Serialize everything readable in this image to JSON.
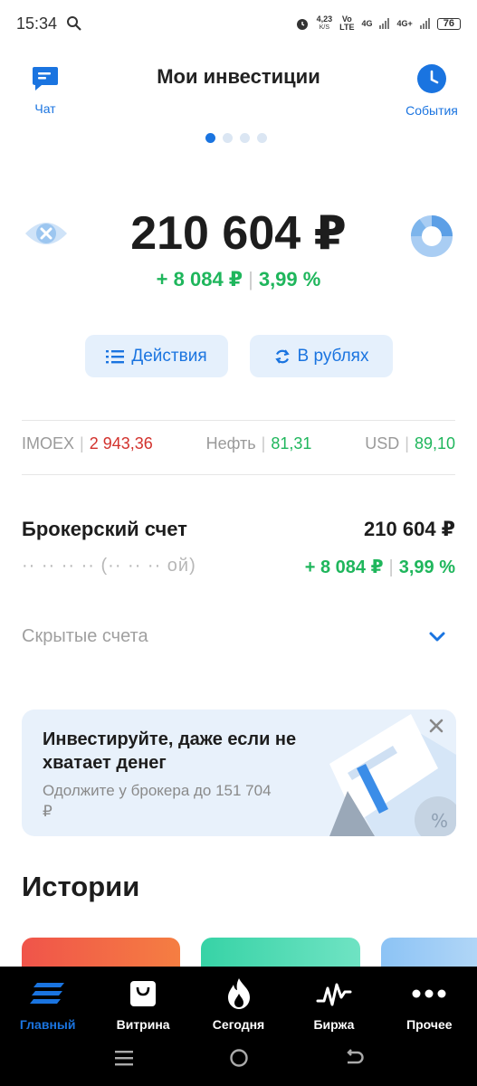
{
  "status_bar": {
    "time": "15:34",
    "speed_value": "4,23",
    "speed_unit": "K/S",
    "volte_top": "Vo",
    "volte_bottom": "LTE",
    "net1": "4G",
    "net2": "4G+",
    "battery": "76"
  },
  "header": {
    "title": "Мои инвестиции",
    "chat_label": "Чат",
    "events_label": "События",
    "page_dots": 4,
    "active_dot": 0
  },
  "portfolio": {
    "total": "210 604 ₽",
    "change_abs": "+ 8 084 ₽",
    "change_pct": "3,99 %"
  },
  "actions": {
    "actions_label": "Действия",
    "currency_label": "В рублях"
  },
  "tickers": [
    {
      "name": "IMOEX",
      "value": "2 943,36",
      "trend": "down"
    },
    {
      "name": "Нефть",
      "value": "81,31",
      "trend": "up"
    },
    {
      "name": "USD",
      "value": "89,10",
      "trend": "up"
    }
  ],
  "broker_account": {
    "name": "Брокерский счет",
    "total": "210 604 ₽",
    "subtitle": "·· ·· ·· ·· (·· ·· ·· ой)",
    "change_abs": "+ 8 084 ₽",
    "change_pct": "3,99 %"
  },
  "hidden_accounts": {
    "label": "Скрытые счета"
  },
  "promo": {
    "title": "Инвестируйте, даже если не хватает денег",
    "text": "Одолжите у брокера до 151 704 ₽"
  },
  "stories": {
    "title": "Истории"
  },
  "tabbar": [
    {
      "label": "Главный",
      "icon": "home-stack-icon",
      "active": true
    },
    {
      "label": "Витрина",
      "icon": "shopping-bag-icon",
      "active": false
    },
    {
      "label": "Сегодня",
      "icon": "flame-icon",
      "active": false
    },
    {
      "label": "Биржа",
      "icon": "pulse-chart-icon",
      "active": false
    },
    {
      "label": "Прочее",
      "icon": "more-dots-icon",
      "active": false
    }
  ],
  "colors": {
    "accent": "#1a74e0",
    "positive": "#1fb65c",
    "negative": "#d2322d",
    "pill_bg": "#e5f0fc",
    "promo_bg": "#e8f1fb"
  }
}
